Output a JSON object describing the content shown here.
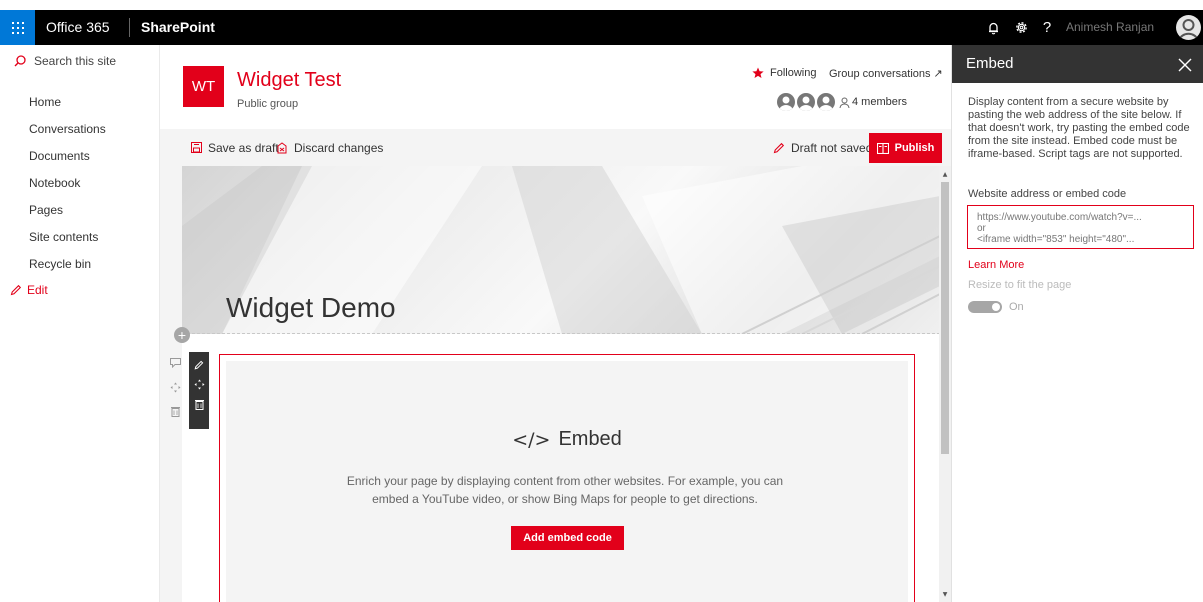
{
  "suite": {
    "brand": "Office 365",
    "app": "SharePoint",
    "user_name": "Animesh Ranjan",
    "help": "?"
  },
  "nav": {
    "search_label": "Search this site",
    "items": [
      {
        "label": "Home"
      },
      {
        "label": "Conversations"
      },
      {
        "label": "Documents"
      },
      {
        "label": "Notebook"
      },
      {
        "label": "Pages"
      },
      {
        "label": "Site contents"
      },
      {
        "label": "Recycle bin"
      }
    ],
    "edit_label": "Edit"
  },
  "site": {
    "logo_initials": "WT",
    "title": "Widget Test",
    "subtitle": "Public group",
    "following_label": "Following",
    "group_conversations_label": "Group conversations ↗",
    "members_label": "4 members"
  },
  "commands": {
    "save_draft": "Save as draft",
    "discard": "Discard changes",
    "draft_status": "Draft not saved",
    "publish": "Publish"
  },
  "page": {
    "hero_title": "Widget Demo"
  },
  "embed_webpart": {
    "glyph": "</>",
    "title": "Embed",
    "description": "Enrich your page by displaying content from other websites. For example, you can embed a YouTube video, or show Bing Maps for people to get directions.",
    "button": "Add embed code"
  },
  "panel": {
    "title": "Embed",
    "description": "Display content from a secure website by pasting the web address of the site below. If that doesn't work, try pasting the embed code from the site instead. Embed code must be iframe-based. Script tags are not supported.",
    "field_label": "Website address or embed code",
    "field_placeholder": "https://www.youtube.com/watch?v=...\nor\n<iframe width=\"853\" height=\"480\"...",
    "learn_more": "Learn More",
    "resize_label": "Resize to fit the page",
    "toggle_state": "On"
  },
  "colors": {
    "accent": "#e2001a",
    "suite_bar": "#000000",
    "waffle": "#0078d7",
    "panel_header": "#333333"
  }
}
